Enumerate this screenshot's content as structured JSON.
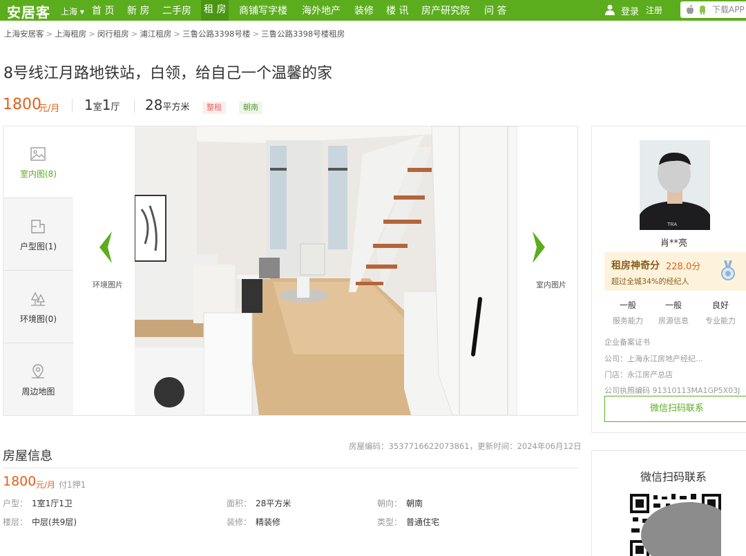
{
  "topnav": {
    "logo": "安居客",
    "city": "上海 ▾",
    "items": [
      "首 页",
      "新 房",
      "二手房",
      "租 房",
      "商铺写字楼",
      "海外地产",
      "装修",
      "楼 讯",
      "房产研究院",
      "问 答"
    ],
    "login": "登录",
    "register": "注册",
    "app_download": "下载APP"
  },
  "breadcrumb": [
    "上海安居客",
    "上海租房",
    "闵行租房",
    "浦江租房",
    "三鲁公路3398号楼",
    "三鲁公路3398号楼租房"
  ],
  "listing": {
    "title": "8号线江月路地铁站，白领，给自己一个温馨的家",
    "price": "1800",
    "price_unit": "元/月",
    "layout_num1": "1",
    "layout_unit1": "室",
    "layout_num2": "1",
    "layout_unit2": "厅",
    "area_num": "28",
    "area_unit": "平方米",
    "tags": [
      "整租",
      "朝南"
    ]
  },
  "gallery": {
    "thumbs": [
      {
        "label": "室内图(8)",
        "icon": "image-icon"
      },
      {
        "label": "户型图(1)",
        "icon": "floorplan-icon"
      },
      {
        "label": "环境图(0)",
        "icon": "trees-icon"
      },
      {
        "label": "周边地图",
        "icon": "map-pin-icon"
      }
    ],
    "prev_label": "环境图片",
    "next_label": "室内图片"
  },
  "agent": {
    "name": "肖**亮",
    "score_label": "租房神奇分",
    "score_value": "228.0分",
    "score_sub": "超过全城34%的经纪人",
    "abilities": [
      {
        "value": "一般",
        "key": "服务能力"
      },
      {
        "value": "一般",
        "key": "房源信息"
      },
      {
        "value": "良好",
        "key": "专业能力"
      }
    ],
    "cert": "企业备案证书",
    "company": "公司：上海永江房地产经纪...",
    "store": "门店：永江房产总店",
    "license": "公司执照编码 91310113MA1GP5X03J",
    "wechat_btn": "微信扫码联系"
  },
  "qr": {
    "title": "微信扫码联系"
  },
  "house_info": {
    "title": "房屋信息",
    "meta": "房屋编码：3537716622073861，更新时间：2024年06月12日",
    "price": "1800",
    "price_unit": "元/月",
    "pay": "付1押1",
    "fields": [
      {
        "k": "户型：",
        "v": "1室1厅1卫"
      },
      {
        "k": "面积：",
        "v": "28平方米"
      },
      {
        "k": "朝向：",
        "v": "朝南"
      },
      {
        "k": "楼层：",
        "v": "中层(共9层)"
      },
      {
        "k": "装修：",
        "v": "精装修"
      },
      {
        "k": "类型：",
        "v": "普通住宅"
      }
    ]
  },
  "colors": {
    "brand_green": "#5cad1e",
    "price_orange": "#e0601a"
  }
}
